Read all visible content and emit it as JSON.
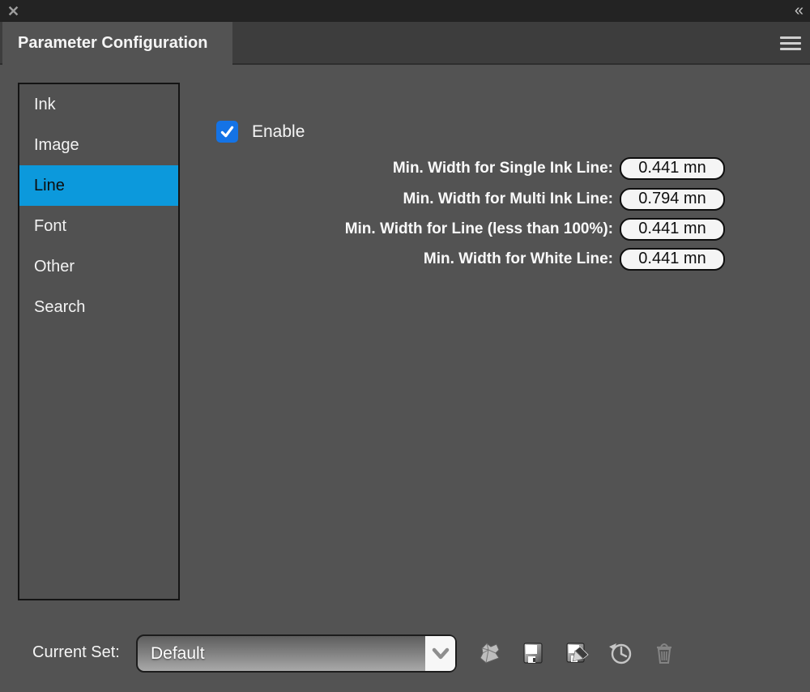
{
  "window": {
    "close_icon_glyph": "✕",
    "collapse_icon_glyph": "«"
  },
  "tab": {
    "title": "Parameter Configuration"
  },
  "sidebar": {
    "items": [
      {
        "label": "Ink",
        "selected": false
      },
      {
        "label": "Image",
        "selected": false
      },
      {
        "label": "Line",
        "selected": true
      },
      {
        "label": "Font",
        "selected": false
      },
      {
        "label": "Other",
        "selected": false
      },
      {
        "label": "Search",
        "selected": false
      }
    ]
  },
  "content": {
    "enable_checkbox": {
      "label": "Enable",
      "checked": true
    },
    "fields": [
      {
        "label": "Min. Width for Single Ink Line:",
        "value": "0.441 mn"
      },
      {
        "label": "Min. Width for Multi Ink Line:",
        "value": "0.794 mn"
      },
      {
        "label": "Min. Width for Line (less than 100%):",
        "value": "0.441 mn"
      },
      {
        "label": "Min. Width for White Line:",
        "value": "0.441 mn"
      }
    ]
  },
  "footer": {
    "current_set_label": "Current Set:",
    "current_set_value": "Default",
    "icons": [
      {
        "name": "import-set-icon",
        "disabled": false
      },
      {
        "name": "save-set-icon",
        "disabled": false
      },
      {
        "name": "save-set-as-icon",
        "disabled": false
      },
      {
        "name": "restore-set-icon",
        "disabled": false
      },
      {
        "name": "delete-set-icon",
        "disabled": true
      }
    ]
  },
  "colors": {
    "titlebar": "#232323",
    "tabstrip": "#3d3d3d",
    "panel": "#535353",
    "selection_blue": "#0c99dc",
    "checkbox_blue": "#1473e6",
    "field_bg": "#f5f5f5",
    "text_light": "#f2f2f2"
  }
}
